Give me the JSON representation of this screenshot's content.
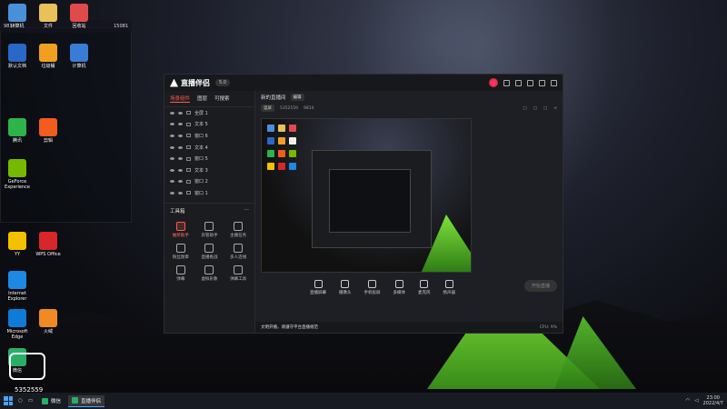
{
  "desktop": {
    "icons": [
      {
        "label": "计算机",
        "color": "#4a90d9"
      },
      {
        "label": "文件",
        "color": "#e8c15a"
      },
      {
        "label": "回收站",
        "color": "#e14a4a"
      },
      {
        "label": "默认文档",
        "color": "#2b67c7"
      },
      {
        "label": "垃圾桶",
        "color": "#f0a020"
      },
      {
        "label": "计算机",
        "color": "#3a7bd5"
      },
      {
        "label": "腾讯",
        "color": "#2db34a"
      },
      {
        "label": "剪辑",
        "color": "#f35b20"
      },
      {
        "label": "GeForce Experience",
        "color": "#76b900"
      },
      {
        "label": "YY",
        "color": "#f3c000"
      },
      {
        "label": "WPS Office",
        "color": "#d8262d"
      },
      {
        "label": "Internet Explorer",
        "color": "#1e88e5"
      },
      {
        "label": "Microsoft Edge",
        "color": "#0f7bd8"
      },
      {
        "label": "火绒",
        "color": "#f08a23"
      },
      {
        "label": "微信",
        "color": "#2aae67"
      }
    ],
    "widget": {
      "a": "9814",
      "b": "15081"
    }
  },
  "window": {
    "title": "直播伴侣",
    "version": "5.0",
    "tabs": [
      "场景组件",
      "图层",
      "可搜索"
    ],
    "scenes": [
      "全屏 1",
      "文本 5",
      "窗口 6",
      "文本 4",
      "窗口 5",
      "文本 3",
      "窗口 2",
      "窗口 1"
    ],
    "tools_title": "工具箱",
    "tools": [
      {
        "label": "抽奖助手",
        "hot": true
      },
      {
        "label": "房管助手",
        "hot": false
      },
      {
        "label": "主播任务",
        "hot": false
      },
      {
        "label": "粉丝勋章",
        "hot": false
      },
      {
        "label": "直播挑战",
        "hot": false
      },
      {
        "label": "多人连线",
        "hot": false
      },
      {
        "label": "弹幕",
        "hot": false
      },
      {
        "label": "虚拟形象",
        "hot": false
      },
      {
        "label": "弹幕工具",
        "hot": false
      }
    ],
    "main_title": "新的直播间",
    "main_tag": "编辑",
    "sub_pill": "竖屏",
    "sub_id": "5352559",
    "sub_fans": "9814",
    "controls": [
      "直播屏幕",
      "摄像头",
      "手机投屏",
      "多媒体",
      "麦克风",
      "扬声器"
    ],
    "start_label": "开始直播",
    "status_warn": "文明开播，请遵守平台直播规范",
    "status_rate": "CPU: 9%"
  },
  "taskbar": {
    "tasks": [
      {
        "label": "微信",
        "active": false
      },
      {
        "label": "直播伴侣",
        "active": true
      }
    ],
    "time": "23:00",
    "date": "2022/4/7"
  },
  "overlay": {
    "text": "5352559"
  }
}
